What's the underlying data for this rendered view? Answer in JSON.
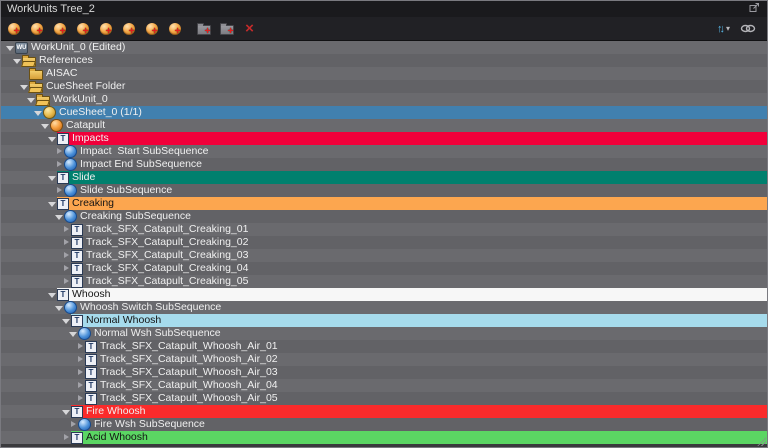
{
  "window": {
    "title": "WorkUnits Tree_2",
    "titlebar_buttons": [
      {
        "name": "lock-button",
        "icon": "unlock-icon"
      },
      {
        "name": "float-window-button",
        "icon": "popout-icon"
      },
      {
        "name": "close-button",
        "icon": "close-icon"
      }
    ]
  },
  "icon_glyphs": {
    "workunit": "WU",
    "track": "T",
    "plus": "+",
    "delete": "×",
    "sort": "↑↓",
    "caret": "▾"
  },
  "toolbar": {
    "left_buttons": [
      {
        "name": "add-cue-polyphonic-button",
        "icon": "cue-add-icon"
      },
      {
        "name": "add-cue-sequential-button",
        "icon": "cue-add-icon"
      },
      {
        "name": "add-cue-shuffle-button",
        "icon": "cue-add-icon"
      },
      {
        "name": "add-cue-random-button",
        "icon": "cue-add-icon"
      },
      {
        "name": "add-cue-random-norepeat-button",
        "icon": "cue-add-icon"
      },
      {
        "name": "add-cue-switch-button",
        "icon": "cue-add-icon"
      },
      {
        "name": "add-cue-combo-sequential-button",
        "icon": "cue-add-icon"
      },
      {
        "name": "add-cue-track-button",
        "icon": "cue-add-icon"
      },
      {
        "name": "add-cuesheet-folder-button",
        "icon": "folder-add-icon"
      },
      {
        "name": "add-folder-button",
        "icon": "folder-add-icon"
      },
      {
        "name": "delete-button",
        "icon": "delete-x-icon"
      }
    ],
    "right_buttons": [
      {
        "name": "sort-order-button",
        "icon": "sort-az-icon"
      },
      {
        "name": "link-button",
        "icon": "link-chain-icon"
      }
    ]
  },
  "palette": {
    "selected_row": "#4180af",
    "row_even": "#6a6a6e",
    "row_odd": "#626266",
    "crimson": "#f1003a",
    "teal": "#00806e",
    "orange": "#fca64f",
    "white_row": "#f7f7f7",
    "light_blue": "#a6dbec",
    "red": "#fa2b2b",
    "green": "#5bd663"
  },
  "tree": {
    "rows": [
      {
        "label": "WorkUnit_0 (Edited)",
        "level": 0,
        "expander": "expanded",
        "icon": "workunit"
      },
      {
        "label": "References",
        "level": 1,
        "expander": "expanded",
        "icon": "folder-open"
      },
      {
        "label": "AISAC",
        "level": 2,
        "expander": "none",
        "icon": "folder"
      },
      {
        "label": "CueSheet Folder",
        "level": 2,
        "expander": "expanded",
        "icon": "folder-open"
      },
      {
        "label": "WorkUnit_0",
        "level": 3,
        "expander": "expanded",
        "icon": "folder-open"
      },
      {
        "label": "CueSheet_0 (1/1)",
        "level": 4,
        "expander": "expanded",
        "icon": "cuesheet",
        "selected": true
      },
      {
        "label": "Catapult",
        "level": 5,
        "expander": "expanded",
        "icon": "cue-orange"
      },
      {
        "label": "Impacts",
        "level": 6,
        "expander": "expanded",
        "icon": "track",
        "highlight": "#f1003a",
        "fg": "light"
      },
      {
        "label": "Impact  Start SubSequence",
        "level": 7,
        "expander": "collapsed",
        "icon": "subsequence"
      },
      {
        "label": "Impact End SubSequence",
        "level": 7,
        "expander": "collapsed",
        "icon": "subsequence"
      },
      {
        "label": "Slide",
        "level": 6,
        "expander": "expanded",
        "icon": "track",
        "highlight": "#00806e",
        "fg": "light"
      },
      {
        "label": "Slide SubSequence",
        "level": 7,
        "expander": "collapsed",
        "icon": "subsequence"
      },
      {
        "label": "Creaking",
        "level": 6,
        "expander": "expanded",
        "icon": "track",
        "highlight": "#fca64f",
        "fg": "dark"
      },
      {
        "label": "Creaking SubSequence",
        "level": 7,
        "expander": "expanded",
        "icon": "subsequence"
      },
      {
        "label": "Track_SFX_Catapult_Creaking_01",
        "level": 8,
        "expander": "collapsed",
        "icon": "track"
      },
      {
        "label": "Track_SFX_Catapult_Creaking_02",
        "level": 8,
        "expander": "collapsed",
        "icon": "track"
      },
      {
        "label": "Track_SFX_Catapult_Creaking_03",
        "level": 8,
        "expander": "collapsed",
        "icon": "track"
      },
      {
        "label": "Track_SFX_Catapult_Creaking_04",
        "level": 8,
        "expander": "collapsed",
        "icon": "track"
      },
      {
        "label": "Track_SFX_Catapult_Creaking_05",
        "level": 8,
        "expander": "collapsed",
        "icon": "track"
      },
      {
        "label": "Whoosh",
        "level": 6,
        "expander": "expanded",
        "icon": "track",
        "highlight": "#f7f7f7",
        "fg": "dark"
      },
      {
        "label": "Whoosh Switch SubSequence",
        "level": 7,
        "expander": "expanded",
        "icon": "subsequence"
      },
      {
        "label": "Normal Whoosh",
        "level": 8,
        "expander": "expanded",
        "icon": "track",
        "highlight": "#a6dbec",
        "fg": "dark"
      },
      {
        "label": "Normal Wsh SubSequence",
        "level": 9,
        "expander": "expanded",
        "icon": "subsequence"
      },
      {
        "label": "Track_SFX_Catapult_Whoosh_Air_01",
        "level": 10,
        "expander": "collapsed",
        "icon": "track"
      },
      {
        "label": "Track_SFX_Catapult_Whoosh_Air_02",
        "level": 10,
        "expander": "collapsed",
        "icon": "track"
      },
      {
        "label": "Track_SFX_Catapult_Whoosh_Air_03",
        "level": 10,
        "expander": "collapsed",
        "icon": "track"
      },
      {
        "label": "Track_SFX_Catapult_Whoosh_Air_04",
        "level": 10,
        "expander": "collapsed",
        "icon": "track"
      },
      {
        "label": "Track_SFX_Catapult_Whoosh_Air_05",
        "level": 10,
        "expander": "collapsed",
        "icon": "track"
      },
      {
        "label": "Fire Whoosh",
        "level": 8,
        "expander": "expanded",
        "icon": "track",
        "highlight": "#fa2b2b",
        "fg": "light"
      },
      {
        "label": "Fire Wsh SubSequence",
        "level": 9,
        "expander": "collapsed",
        "icon": "subsequence"
      },
      {
        "label": "Acid Whoosh",
        "level": 8,
        "expander": "collapsed",
        "icon": "track",
        "highlight": "#5bd663",
        "fg": "dark"
      }
    ]
  }
}
